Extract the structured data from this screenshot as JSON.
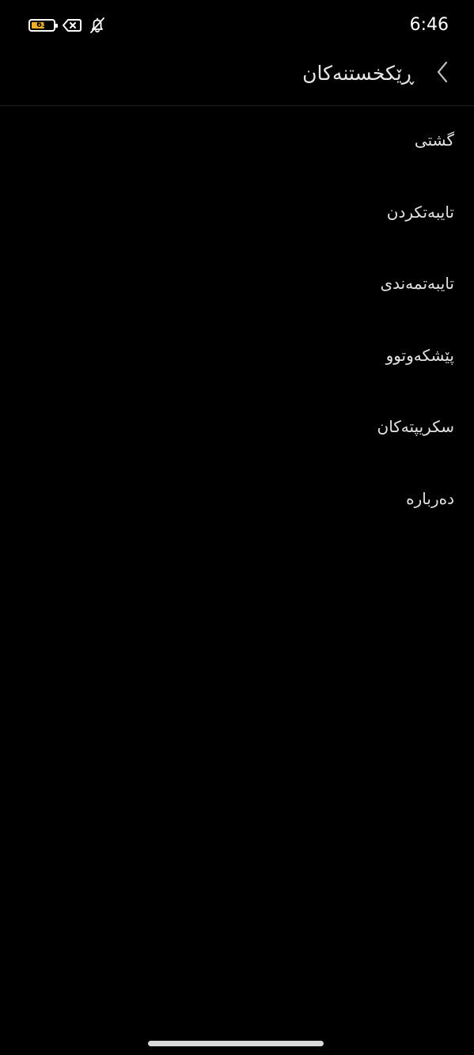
{
  "status_bar": {
    "time": "6:46",
    "battery_level": "63",
    "battery_fraction": 0.63,
    "battery_fill_color": "#f2b124",
    "icons": [
      "battery-icon",
      "no-sim-icon",
      "notifications-off-icon"
    ]
  },
  "header": {
    "title": "ڕێکخستنەکان",
    "back_icon": "chevron-left-icon"
  },
  "menu": {
    "items": [
      {
        "label": "گشتی"
      },
      {
        "label": "تایبەتکردن"
      },
      {
        "label": "تایبەتمەندی"
      },
      {
        "label": "پێشکەوتوو"
      },
      {
        "label": "سکریپتەکان"
      },
      {
        "label": "دەربارە"
      }
    ]
  }
}
